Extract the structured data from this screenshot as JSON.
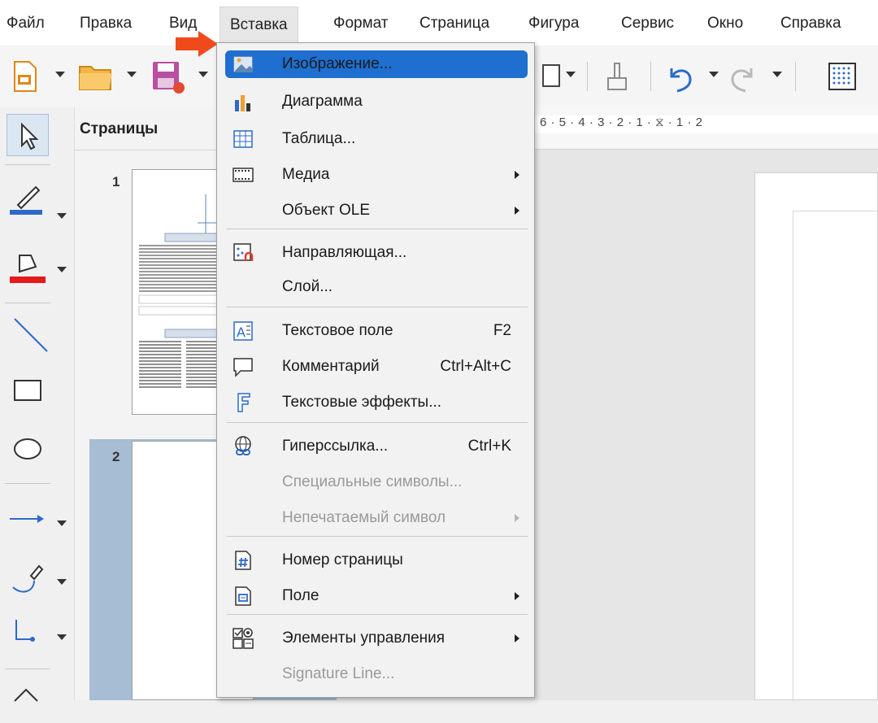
{
  "menubar": {
    "items": [
      "Файл",
      "Правка",
      "Вид",
      "Вставка",
      "Формат",
      "Страница",
      "Фигура",
      "Сервис",
      "Окно",
      "Справка"
    ],
    "active": "Вставка"
  },
  "pages_panel": {
    "title": "Страницы",
    "pages": [
      {
        "number": "1",
        "heading_top": "Stray heading text",
        "heading_bottom": "Second section"
      },
      {
        "number": "2"
      }
    ]
  },
  "ruler": {
    "ticks": "6 · 5 · 4 · 3 · 2 · 1 · ⧖ · 1 · 2"
  },
  "insert_menu": {
    "items": [
      {
        "label": "Изображение...",
        "icon": "image-icon",
        "highlighted": true
      },
      {
        "label": "Диаграмма",
        "icon": "chart-icon"
      },
      {
        "label": "Таблица...",
        "icon": "table-icon"
      },
      {
        "label": "Медиа",
        "icon": "media-icon",
        "submenu": true
      },
      {
        "label": "Объект OLE",
        "submenu": true
      },
      {
        "label": "Направляющая...",
        "icon": "guide-icon"
      },
      {
        "label": "Слой..."
      },
      {
        "label": "Текстовое поле",
        "icon": "textbox-icon",
        "shortcut": "F2"
      },
      {
        "label": "Комментарий",
        "icon": "comment-icon",
        "shortcut": "Ctrl+Alt+C"
      },
      {
        "label": "Текстовые эффекты...",
        "icon": "fontwork-icon"
      },
      {
        "label": "Гиперссылка...",
        "icon": "hyperlink-icon",
        "shortcut": "Ctrl+K"
      },
      {
        "label": "Специальные символы...",
        "disabled": true
      },
      {
        "label": "Непечатаемый символ",
        "disabled": true,
        "submenu": true
      },
      {
        "label": "Номер страницы",
        "icon": "page-number-icon"
      },
      {
        "label": "Поле",
        "icon": "field-icon",
        "submenu": true
      },
      {
        "label": "Элементы управления",
        "icon": "form-controls-icon",
        "submenu": true
      },
      {
        "label": "Signature Line...",
        "disabled": true
      }
    ]
  },
  "colors": {
    "highlight": "#1e6fd0",
    "arrow": "#f04a1c",
    "pages_selected": "#a6bdd3"
  }
}
